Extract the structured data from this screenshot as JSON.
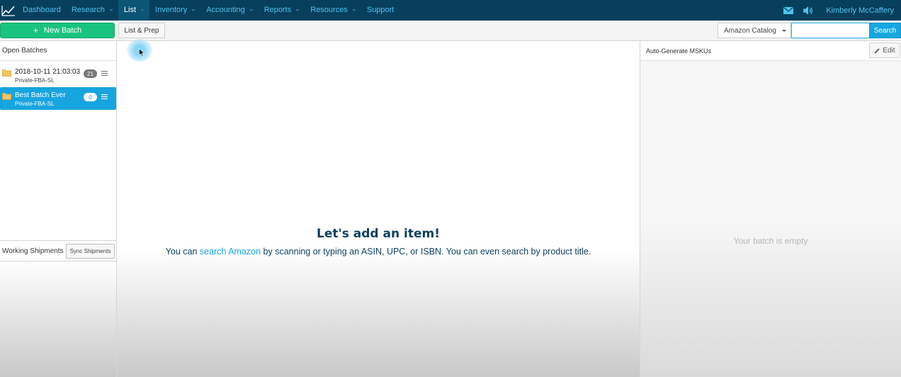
{
  "nav": {
    "items": [
      {
        "label": "Dashboard",
        "has_caret": false,
        "active": false
      },
      {
        "label": "Research",
        "has_caret": true,
        "active": false
      },
      {
        "label": "List",
        "has_caret": true,
        "active": true
      },
      {
        "label": "Inventory",
        "has_caret": true,
        "active": false
      },
      {
        "label": "Accounting",
        "has_caret": true,
        "active": false
      },
      {
        "label": "Reports",
        "has_caret": true,
        "active": false
      },
      {
        "label": "Resources",
        "has_caret": true,
        "active": false
      },
      {
        "label": "Support",
        "has_caret": false,
        "active": false
      }
    ],
    "icons": [
      "chart-logo-icon",
      "mail-icon",
      "speaker-icon"
    ],
    "user_name": "Kimberly McCaffery"
  },
  "toolbar": {
    "new_batch_label": "New Batch",
    "new_batch_icon": "+",
    "list_prep_label": "List & Prep",
    "catalog_selected": "Amazon Catalog",
    "search_value": "",
    "search_label": "Search"
  },
  "left": {
    "open_batches_title": "Open Batches",
    "batches": [
      {
        "name": "2018-10-11 21:03:03",
        "subtitle": "Private-FBA-SL",
        "count": "21",
        "selected": false
      },
      {
        "name": "Best Batch Ever",
        "subtitle": "Private-FBA-SL",
        "count": "0",
        "selected": true
      }
    ],
    "working_shipments_title": "Working Shipments",
    "sync_label": "Sync Shipments"
  },
  "center": {
    "title": "Let's add an item!",
    "desc_before": "You can ",
    "desc_link": "search Amazon",
    "desc_after": " by scanning or typing an ASIN, UPC, or ISBN. You can even search by product title."
  },
  "right": {
    "header_title": "Auto-Generate MSKUs",
    "edit_label": "Edit",
    "empty_label": "Your batch is empty"
  },
  "colors": {
    "nav_bg": "#073f5c",
    "nav_link": "#4fc3f0",
    "accent_green": "#19c37f",
    "accent_blue": "#16a7e0",
    "heading_dark": "#0c3f5c"
  }
}
